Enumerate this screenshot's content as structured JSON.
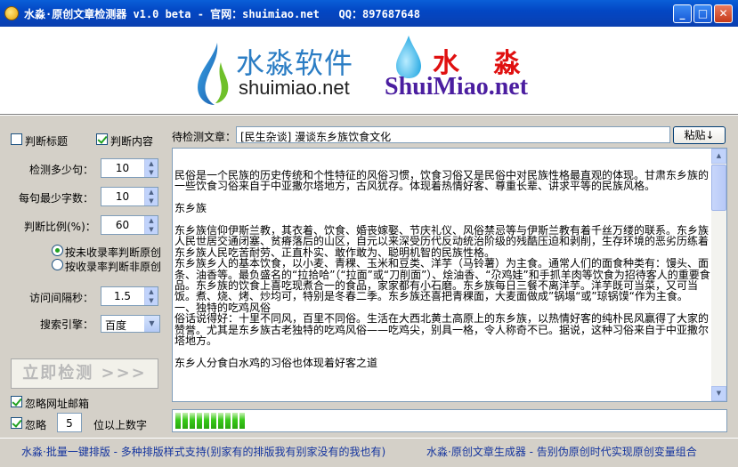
{
  "window": {
    "title": "水淼·原创文章检测器 v1.0 beta - 官网：shuimiao.net   QQ：897687648"
  },
  "header": {
    "brand_cn": "水淼软件",
    "brand_url": "shuimiao.net",
    "brand_cn2": "水 淼",
    "brand_en": "ShuiMiao.net"
  },
  "options": {
    "check_title_label": "判断标题",
    "check_title": false,
    "check_content_label": "判断内容",
    "check_content": true,
    "sentences_label": "检测多少句：",
    "sentences_value": "10",
    "min_chars_label": "每句最少字数：",
    "min_chars_value": "10",
    "ratio_label": "判断比例(%)：",
    "ratio_value": "60",
    "radio_included_label": "按未收录率判断原创",
    "radio_not_included_label": "按收录率判断非原创",
    "radio_selected": "included",
    "interval_label": "访问间隔秒：",
    "interval_value": "1.5",
    "engine_label": "搜索引擎：",
    "engine_value": "百度"
  },
  "actions": {
    "start_label": "立即检测 >>>",
    "ignore_url_label": "忽略网址邮箱",
    "ignore_url": true,
    "ignore_digits_label": "忽略",
    "ignore_digits": true,
    "ignore_digits_value": "5",
    "ignore_digits_suffix": "位以上数字"
  },
  "article": {
    "label": "待检测文章：",
    "title_value": "[民生杂谈] 漫谈东乡族饮食文化",
    "paste_label": "粘贴↓",
    "paragraphs": [
      "民俗是一个民族的历史传统和个性特征的风俗习惯，饮食习俗又是民俗中对民族性格最直观的体现。甘肃东乡族的一些饮食习俗来自于中亚撒尔塔地方，古风犹存。体现着热情好客、尊重长辈、讲求平等的民族风格。",
      "东乡族",
      "东乡族信仰伊斯兰教，其衣着、饮食、婚丧嫁娶、节庆礼仪、风俗禁忌等与伊斯兰教有着千丝万缕的联系。东乡族人民世居交通闭塞、贫瘠落后的山区，自元以来深受历代反动统治阶级的残酷压迫和剥削，生存环境的恶劣历练着东乡族人民吃苦耐劳、正直朴实、敢作敢为、聪明机智的民族性格。",
      "东乡族乡人的基本饮食，以小麦、青稞、玉米和豆类、洋芋（马铃薯）为主食。通常人们的面食种类有：馒头、面条、油香等。最负盛名的“拉拾哈”（“拉面”或“刀削面”）、烩油香、“尕鸡娃”和手抓羊肉等饮食为招待客人的重要食品。东乡族的饮食上喜吃现煮合一的食品，家家都有小石磨。东乡族每日三餐不离洋芋。洋芋既可当菜，又可当饭。煮、烧、烤、炒均可，特别是冬春二季。东乡族还喜把青稞面，大麦面做成”锅塌“或”琼锅馍“作为主食。",
      "一、独特的吃鸡风俗",
      "俗话说得好：十里不同风，百里不同俗。生活在大西北黄土高原上的东乡族，以热情好客的纯朴民风赢得了大家的赞誉。尤其是东乡族古老独特的吃鸡风俗——吃鸡尖，别具一格，令人称奇不已。据说，这种习俗来自于中亚撒尔塔地方。",
      "东乡人分食白水鸡的习俗也体现着好客之道"
    ]
  },
  "progress": {
    "value": 0.1,
    "segments": 10
  },
  "footer": {
    "left_text": "水淼·批量一键排版 - 多种排版样式支持(别家有的排版我有别家没有的我也有)",
    "right_text": "水淼·原创文章生成器 - 告别伪原创时代实现原创变量组合"
  },
  "colors": {
    "titlebar": "#0347c4",
    "brand_blue": "#2b7dc4",
    "brand_red": "#e01010",
    "brand_purple": "#4b1ea0",
    "progress_green": "#37c918",
    "footer_text": "#14349e"
  }
}
